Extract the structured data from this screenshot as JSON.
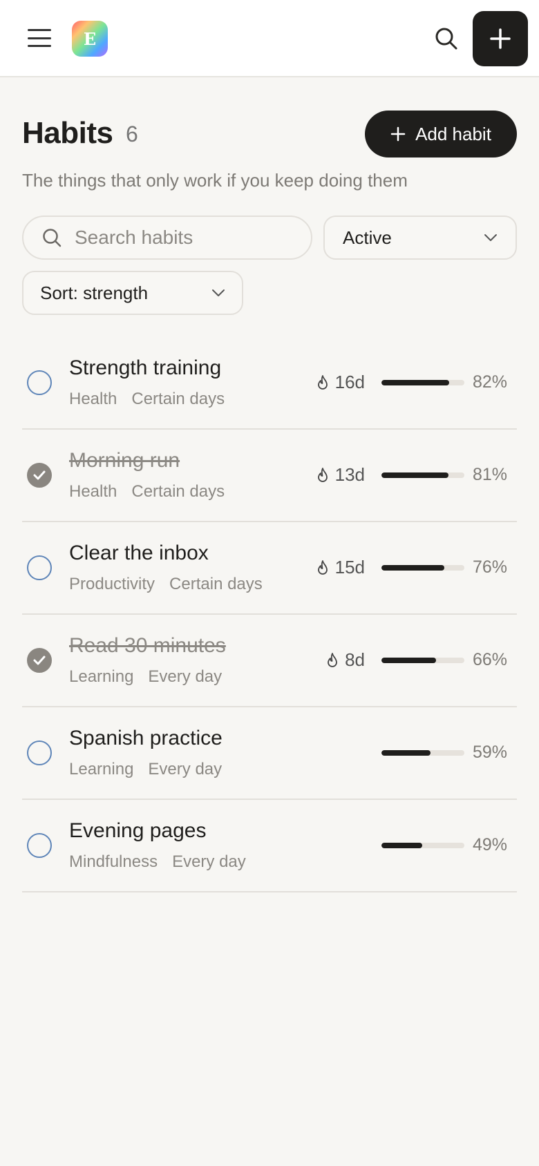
{
  "app": {
    "logo_letter": "E"
  },
  "header": {
    "title": "Habits",
    "count": "6",
    "add_button_label": "Add habit",
    "subtitle": "The things that only work if you keep doing them"
  },
  "filters": {
    "search_placeholder": "Search habits",
    "status_value": "Active",
    "sort_value": "Sort: strength"
  },
  "colors": {
    "accent": "#1f1e1c",
    "background": "#f7f6f3",
    "checkbox_outline": "#5e85b8",
    "checkbox_done": "#8a8680"
  },
  "habits": [
    {
      "name": "Strength training",
      "category": "Health",
      "schedule": "Certain days",
      "done": false,
      "streak": "16d",
      "strength": 82,
      "strength_label": "82%"
    },
    {
      "name": "Morning run",
      "category": "Health",
      "schedule": "Certain days",
      "done": true,
      "streak": "13d",
      "strength": 81,
      "strength_label": "81%"
    },
    {
      "name": "Clear the inbox",
      "category": "Productivity",
      "schedule": "Certain days",
      "done": false,
      "streak": "15d",
      "strength": 76,
      "strength_label": "76%"
    },
    {
      "name": "Read 30 minutes",
      "category": "Learning",
      "schedule": "Every day",
      "done": true,
      "streak": "8d",
      "strength": 66,
      "strength_label": "66%"
    },
    {
      "name": "Spanish practice",
      "category": "Learning",
      "schedule": "Every day",
      "done": false,
      "streak": "",
      "strength": 59,
      "strength_label": "59%"
    },
    {
      "name": "Evening pages",
      "category": "Mindfulness",
      "schedule": "Every day",
      "done": false,
      "streak": "",
      "strength": 49,
      "strength_label": "49%"
    }
  ]
}
